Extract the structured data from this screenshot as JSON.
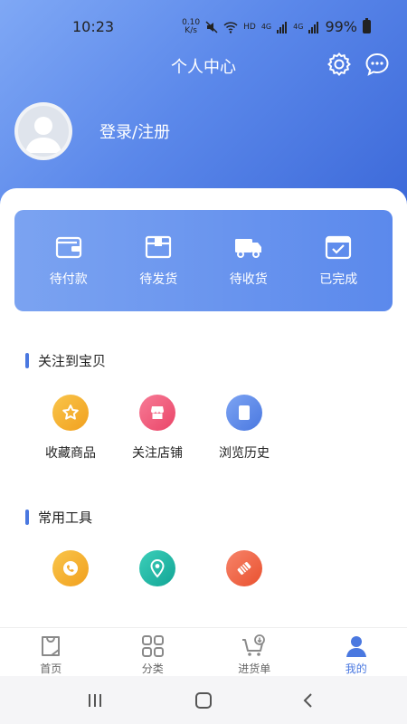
{
  "status_bar": {
    "time": "10:23",
    "net_speed_top": "0.10",
    "net_speed_bottom": "K/s",
    "hd_label": "HD",
    "signal_label_1": "4G",
    "signal_label_2": "4G",
    "battery": "99%"
  },
  "header": {
    "title": "个人中心",
    "login_text": "登录/注册"
  },
  "orders": {
    "items": [
      {
        "label": "待付款",
        "icon": "wallet-icon"
      },
      {
        "label": "待发货",
        "icon": "box-icon"
      },
      {
        "label": "待收货",
        "icon": "truck-icon"
      },
      {
        "label": "已完成",
        "icon": "calendar-check-icon"
      }
    ]
  },
  "favorites": {
    "title": "关注到宝贝",
    "items": [
      {
        "label": "收藏商品",
        "icon": "star-icon",
        "color": "#f5a623"
      },
      {
        "label": "关注店铺",
        "icon": "store-icon",
        "color": "#f0577a"
      },
      {
        "label": "浏览历史",
        "icon": "history-icon",
        "color": "#5b88ea"
      }
    ]
  },
  "tools": {
    "title": "常用工具",
    "items": [
      {
        "icon": "phone-icon",
        "color": "#f5a623"
      },
      {
        "icon": "location-icon",
        "color": "#1fb8a8"
      },
      {
        "icon": "eraser-icon",
        "color": "#f0603e"
      }
    ]
  },
  "bottom_nav": {
    "items": [
      {
        "label": "首页",
        "icon": "home-bag-icon"
      },
      {
        "label": "分类",
        "icon": "grid-icon"
      },
      {
        "label": "进货单",
        "icon": "cart-icon"
      },
      {
        "label": "我的",
        "icon": "user-icon",
        "active": true
      }
    ]
  },
  "colors": {
    "accent": "#4a78e0",
    "header_gradient_start": "#7fa8f5",
    "header_gradient_end": "#3a67d8"
  }
}
